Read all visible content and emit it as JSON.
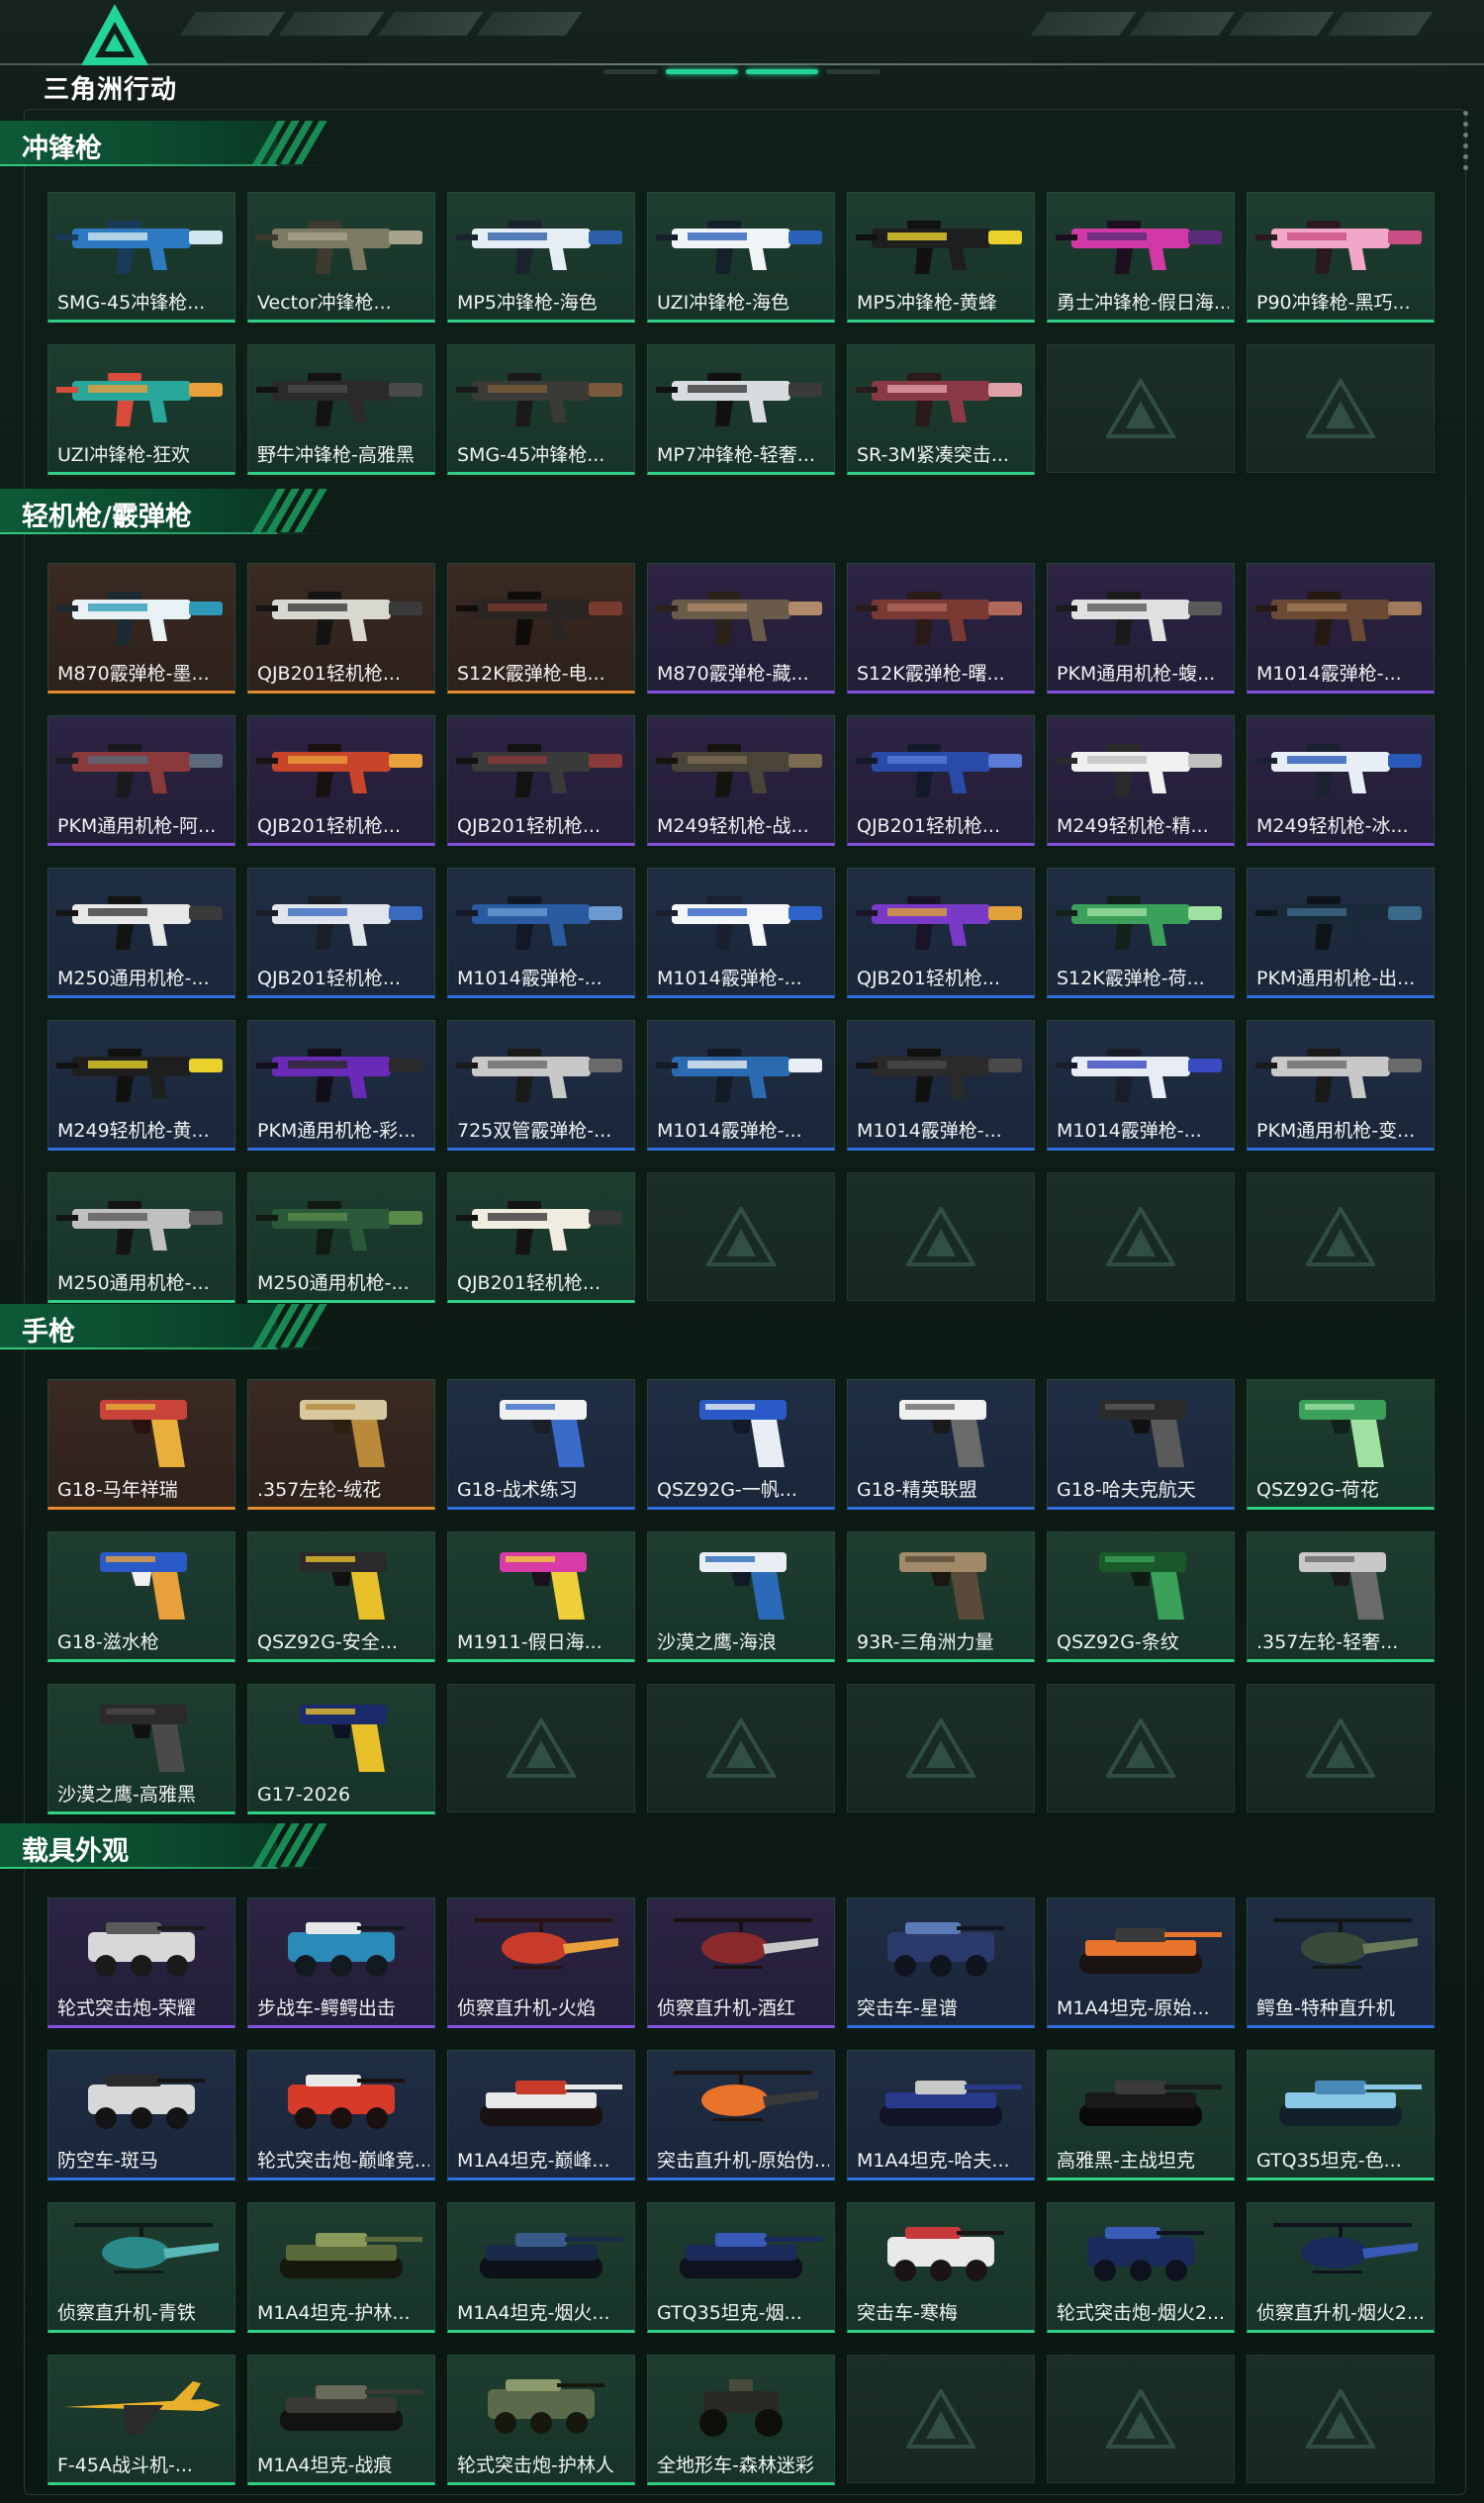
{
  "header": {
    "logo_text": "三角洲行动"
  },
  "sections": [
    {
      "title": "冲锋枪",
      "kind": "gun",
      "items": [
        {
          "label": "SMG-45冲锋枪...",
          "rarity": "green",
          "colors": [
            "#2e7ac2",
            "#d0e8f0",
            "#1a3a5a"
          ]
        },
        {
          "label": "Vector冲锋枪...",
          "rarity": "green",
          "colors": [
            "#7c7a63",
            "#a8a38c",
            "#3d3b30"
          ]
        },
        {
          "label": "MP5冲锋枪-海色",
          "rarity": "green",
          "colors": [
            "#e6eef5",
            "#2d5ea8",
            "#1b2230"
          ]
        },
        {
          "label": "UZI冲锋枪-海色",
          "rarity": "green",
          "colors": [
            "#f1f4f6",
            "#2b62b9",
            "#15202c"
          ]
        },
        {
          "label": "MP5冲锋枪-黄蜂",
          "rarity": "green",
          "colors": [
            "#1e1e1e",
            "#e8d22b",
            "#111111"
          ]
        },
        {
          "label": "勇士冲锋枪-假日海...",
          "rarity": "green",
          "colors": [
            "#d13aa6",
            "#5b2a7a",
            "#1a1020"
          ]
        },
        {
          "label": "P90冲锋枪-黑巧...",
          "rarity": "green",
          "colors": [
            "#f2a7c8",
            "#c94f86",
            "#2a1a20"
          ]
        },
        {
          "label": "UZI冲锋枪-狂欢",
          "rarity": "green",
          "colors": [
            "#29a79a",
            "#e8a03b",
            "#d84a3a"
          ]
        },
        {
          "label": "野牛冲锋枪-高雅黑",
          "rarity": "green",
          "colors": [
            "#2a2a2a",
            "#4a4a4a",
            "#121212"
          ]
        },
        {
          "label": "SMG-45冲锋枪...",
          "rarity": "green",
          "colors": [
            "#3a3a36",
            "#7a5a3a",
            "#1a1a1a"
          ]
        },
        {
          "label": "MP7冲锋枪-轻奢...",
          "rarity": "green",
          "colors": [
            "#d8dce0",
            "#3a3a3a",
            "#111111"
          ]
        },
        {
          "label": "SR-3M紧凑突击...",
          "rarity": "green",
          "colors": [
            "#8a3a44",
            "#e0a0a8",
            "#2a1a1c"
          ]
        },
        {
          "label": "",
          "rarity": "empty"
        },
        {
          "label": "",
          "rarity": "empty"
        }
      ]
    },
    {
      "title": "轻机枪/霰弹枪",
      "kind": "gun",
      "items": [
        {
          "label": "M870霰弹枪-墨...",
          "rarity": "orange",
          "colors": [
            "#e8f2f5",
            "#2f9ab8",
            "#1a2a30"
          ]
        },
        {
          "label": "QJB201轻机枪...",
          "rarity": "orange",
          "colors": [
            "#d8d8d0",
            "#3a3a3a",
            "#141414"
          ]
        },
        {
          "label": "S12K霰弹枪-电...",
          "rarity": "orange",
          "colors": [
            "#2a2422",
            "#7a3a30",
            "#100c0a"
          ]
        },
        {
          "label": "M870霰弹枪-藏...",
          "rarity": "purple",
          "colors": [
            "#6a5a4a",
            "#b08a6a",
            "#2a221a"
          ]
        },
        {
          "label": "S12K霰弹枪-曙...",
          "rarity": "purple",
          "colors": [
            "#7a3a34",
            "#b0685a",
            "#2a1a16"
          ]
        },
        {
          "label": "PKM通用机枪-蝮...",
          "rarity": "purple",
          "colors": [
            "#e0e0e0",
            "#5a5a5a",
            "#1a1a1a"
          ]
        },
        {
          "label": "M1014霰弹枪-...",
          "rarity": "purple",
          "colors": [
            "#6a4a34",
            "#a07a5a",
            "#241a12"
          ]
        },
        {
          "label": "PKM通用机枪-阿...",
          "rarity": "purple",
          "colors": [
            "#8a3a3a",
            "#5a6a7a",
            "#1a1a1e"
          ]
        },
        {
          "label": "QJB201轻机枪...",
          "rarity": "purple",
          "colors": [
            "#c8442a",
            "#e8a03a",
            "#1a1210"
          ]
        },
        {
          "label": "QJB201轻机枪...",
          "rarity": "purple",
          "colors": [
            "#3a3a3a",
            "#8a3a3a",
            "#121212"
          ]
        },
        {
          "label": "M249轻机枪-战...",
          "rarity": "purple",
          "colors": [
            "#4a4438",
            "#7a6a50",
            "#16140f"
          ]
        },
        {
          "label": "QJB201轻机枪...",
          "rarity": "purple",
          "colors": [
            "#2a4aa8",
            "#5a7ad8",
            "#121a2a"
          ]
        },
        {
          "label": "M249轻机枪-精...",
          "rarity": "purple",
          "colors": [
            "#f0f0f0",
            "#c0c0c0",
            "#2a2a2a"
          ]
        },
        {
          "label": "M249轻机枪-冰...",
          "rarity": "purple",
          "colors": [
            "#e8eef5",
            "#2a5ab8",
            "#1a2130"
          ]
        },
        {
          "label": "M250通用机枪-...",
          "rarity": "blue",
          "colors": [
            "#e8e8e8",
            "#3a3a3a",
            "#141414"
          ]
        },
        {
          "label": "QJB201轻机枪...",
          "rarity": "blue",
          "colors": [
            "#e0e6ec",
            "#3a6ac0",
            "#1a1e26"
          ]
        },
        {
          "label": "M1014霰弹枪-...",
          "rarity": "blue",
          "colors": [
            "#2a5aa0",
            "#6a9ad0",
            "#121826"
          ]
        },
        {
          "label": "M1014霰弹枪-...",
          "rarity": "blue",
          "colors": [
            "#f4f6f8",
            "#2f62c8",
            "#1a2030"
          ]
        },
        {
          "label": "QJB201轻机枪...",
          "rarity": "blue",
          "colors": [
            "#7a3ac8",
            "#e0a03a",
            "#1a1428"
          ]
        },
        {
          "label": "S12K霰弹枪-荷...",
          "rarity": "blue",
          "colors": [
            "#3aa05a",
            "#a0e0a0",
            "#12221a"
          ]
        },
        {
          "label": "PKM通用机枪-出...",
          "rarity": "blue",
          "colors": [
            "#1a2a3a",
            "#3a6a8a",
            "#0e141a"
          ]
        },
        {
          "label": "M249轻机枪-黄...",
          "rarity": "blue",
          "colors": [
            "#1e1e1e",
            "#e8d22b",
            "#111111"
          ]
        },
        {
          "label": "PKM通用机枪-彩...",
          "rarity": "blue",
          "colors": [
            "#6a2ab8",
            "#2a2a2a",
            "#120e1a"
          ]
        },
        {
          "label": "725双管霰弹枪-...",
          "rarity": "blue",
          "colors": [
            "#c8c8c8",
            "#6a6a6a",
            "#1a1a1a"
          ]
        },
        {
          "label": "M1014霰弹枪-...",
          "rarity": "blue",
          "colors": [
            "#2a6ab0",
            "#e8eef4",
            "#121a26"
          ]
        },
        {
          "label": "M1014霰弹枪-...",
          "rarity": "blue",
          "colors": [
            "#2a2a2a",
            "#4a4a4a",
            "#111111"
          ]
        },
        {
          "label": "M1014霰弹枪-...",
          "rarity": "blue",
          "colors": [
            "#e8ecf4",
            "#3a4ac0",
            "#1a1e2a"
          ]
        },
        {
          "label": "PKM通用机枪-变...",
          "rarity": "blue",
          "colors": [
            "#c8c8c8",
            "#6a6a6a",
            "#1a1a1a"
          ]
        },
        {
          "label": "M250通用机枪-...",
          "rarity": "green",
          "colors": [
            "#c0c0c0",
            "#5a5a5a",
            "#141414"
          ]
        },
        {
          "label": "M250通用机枪-...",
          "rarity": "green",
          "colors": [
            "#2a5a3a",
            "#5a8a4a",
            "#121a14"
          ]
        },
        {
          "label": "QJB201轻机枪...",
          "rarity": "green",
          "colors": [
            "#f0ece0",
            "#3a3a3a",
            "#141414"
          ]
        },
        {
          "label": "",
          "rarity": "empty"
        },
        {
          "label": "",
          "rarity": "empty"
        },
        {
          "label": "",
          "rarity": "empty"
        },
        {
          "label": "",
          "rarity": "empty"
        }
      ]
    },
    {
      "title": "手枪",
      "kind": "pistol",
      "items": [
        {
          "label": "G18-马年祥瑞",
          "rarity": "orange",
          "colors": [
            "#c8443a",
            "#e8b03a",
            "#2a1210"
          ]
        },
        {
          "label": ".357左轮-绒花",
          "rarity": "orange",
          "colors": [
            "#d8c8a0",
            "#b88a3a",
            "#2a2010"
          ]
        },
        {
          "label": "G18-战术练习",
          "rarity": "blue",
          "colors": [
            "#f0f0f0",
            "#3a6ac8",
            "#1a1e26"
          ]
        },
        {
          "label": "QSZ92G-一帆...",
          "rarity": "blue",
          "colors": [
            "#2a5ac8",
            "#e8eef4",
            "#121a2a"
          ]
        },
        {
          "label": "G18-精英联盟",
          "rarity": "blue",
          "colors": [
            "#f0f0f0",
            "#6a6a6a",
            "#1a1a1a"
          ]
        },
        {
          "label": "G18-哈夫克航天",
          "rarity": "blue",
          "colors": [
            "#2a2a2a",
            "#5a5a5a",
            "#111111"
          ]
        },
        {
          "label": "QSZ92G-荷花",
          "rarity": "green",
          "colors": [
            "#3aa05a",
            "#a0e0a0",
            "#12221a"
          ]
        },
        {
          "label": "G18-滋水枪",
          "rarity": "green",
          "colors": [
            "#2a5ac8",
            "#e8a03a",
            "#f0f0f0"
          ]
        },
        {
          "label": "QSZ92G-安全...",
          "rarity": "green",
          "colors": [
            "#2a2a2a",
            "#e8c02a",
            "#111111"
          ]
        },
        {
          "label": "M1911-假日海...",
          "rarity": "green",
          "colors": [
            "#d83aa6",
            "#f0d03a",
            "#1a1020"
          ]
        },
        {
          "label": "沙漠之鹰-海浪",
          "rarity": "green",
          "colors": [
            "#e8eef4",
            "#2a6ab8",
            "#121a26"
          ]
        },
        {
          "label": "93R-三角洲力量",
          "rarity": "green",
          "colors": [
            "#a08a6a",
            "#5a4a3a",
            "#1a1610"
          ]
        },
        {
          "label": "QSZ92G-条纹",
          "rarity": "green",
          "colors": [
            "#1a5a2a",
            "#3aa05a",
            "#0e1a12"
          ]
        },
        {
          "label": ".357左轮-轻奢...",
          "rarity": "green",
          "colors": [
            "#c8c8c8",
            "#6a6a6a",
            "#1a1a1a"
          ]
        },
        {
          "label": "沙漠之鹰-高雅黑",
          "rarity": "green",
          "colors": [
            "#2a2a2a",
            "#4a4a4a",
            "#111111"
          ]
        },
        {
          "label": "G17-2026",
          "rarity": "green",
          "colors": [
            "#1a2a6a",
            "#e8c02a",
            "#0e1226"
          ]
        },
        {
          "label": "",
          "rarity": "empty"
        },
        {
          "label": "",
          "rarity": "empty"
        },
        {
          "label": "",
          "rarity": "empty"
        },
        {
          "label": "",
          "rarity": "empty"
        },
        {
          "label": "",
          "rarity": "empty"
        }
      ]
    },
    {
      "title": "载具外观",
      "kind": "vehicle",
      "items": [
        {
          "label": "轮式突击炮-荣耀",
          "rarity": "purple",
          "colors": [
            "#d8d8d8",
            "#5a5a5a",
            "#1a1a1a"
          ],
          "vehicle": "wheeled"
        },
        {
          "label": "步战车-鳄鳄出击",
          "rarity": "purple",
          "colors": [
            "#2a8ab8",
            "#e8e8e8",
            "#121a20"
          ],
          "vehicle": "wheeled"
        },
        {
          "label": "侦察直升机-火焰",
          "rarity": "purple",
          "colors": [
            "#c83a2a",
            "#e8a03a",
            "#2a1210"
          ],
          "vehicle": "heli"
        },
        {
          "label": "侦察直升机-酒红",
          "rarity": "purple",
          "colors": [
            "#8a2a2a",
            "#c8c8c8",
            "#1a1010"
          ],
          "vehicle": "heli"
        },
        {
          "label": "突击车-星谱",
          "rarity": "blue",
          "colors": [
            "#2a3a6a",
            "#5a7ab8",
            "#10141e"
          ],
          "vehicle": "car"
        },
        {
          "label": "M1A4坦克-原始...",
          "rarity": "blue",
          "colors": [
            "#e8732a",
            "#3a3a3a",
            "#1a1410"
          ],
          "vehicle": "tank"
        },
        {
          "label": "鳄鱼-特种直升机",
          "rarity": "blue",
          "colors": [
            "#3a4a3a",
            "#6a7a5a",
            "#121612"
          ],
          "vehicle": "heli"
        },
        {
          "label": "防空车-斑马",
          "rarity": "blue",
          "colors": [
            "#d8d8d8",
            "#2a2a2a",
            "#141414"
          ],
          "vehicle": "wheeled"
        },
        {
          "label": "轮式突击炮-巅峰竞...",
          "rarity": "blue",
          "colors": [
            "#d83a2a",
            "#e8e8e8",
            "#1a1010"
          ],
          "vehicle": "car"
        },
        {
          "label": "M1A4坦克-巅峰...",
          "rarity": "blue",
          "colors": [
            "#e8e8e8",
            "#c83a2a",
            "#1a1212"
          ],
          "vehicle": "tank"
        },
        {
          "label": "突击直升机-原始伪...",
          "rarity": "blue",
          "colors": [
            "#e8732a",
            "#3a3a3a",
            "#1a1410"
          ],
          "vehicle": "heli"
        },
        {
          "label": "M1A4坦克-哈夫...",
          "rarity": "blue",
          "colors": [
            "#2a3a8a",
            "#c8c8c8",
            "#101426"
          ],
          "vehicle": "tank"
        },
        {
          "label": "高雅黑-主战坦克",
          "rarity": "green",
          "colors": [
            "#1a1a1a",
            "#3a3a3a",
            "#0a0a0a"
          ],
          "vehicle": "tank"
        },
        {
          "label": "GTQ35坦克-色...",
          "rarity": "green",
          "colors": [
            "#8ac8e8",
            "#4a8ab8",
            "#12202a"
          ],
          "vehicle": "tank"
        },
        {
          "label": "侦察直升机-青铁",
          "rarity": "green",
          "colors": [
            "#2a8a8a",
            "#5ab8b8",
            "#0e1a1a"
          ],
          "vehicle": "heli"
        },
        {
          "label": "M1A4坦克-护林...",
          "rarity": "green",
          "colors": [
            "#5a6a3a",
            "#8a9a5a",
            "#16180e"
          ],
          "vehicle": "tank"
        },
        {
          "label": "M1A4坦克-烟火...",
          "rarity": "green",
          "colors": [
            "#1a2a4a",
            "#3a5a8a",
            "#0e1218"
          ],
          "vehicle": "tank"
        },
        {
          "label": "GTQ35坦克-烟...",
          "rarity": "green",
          "colors": [
            "#1a2a5a",
            "#3a5ab8",
            "#0e121e"
          ],
          "vehicle": "tank"
        },
        {
          "label": "突击车-寒梅",
          "rarity": "green",
          "colors": [
            "#e8e8e8",
            "#c83a3a",
            "#1a1414"
          ],
          "vehicle": "car"
        },
        {
          "label": "轮式突击炮-烟火2...",
          "rarity": "green",
          "colors": [
            "#1a2a5a",
            "#3a5ab8",
            "#0e121e"
          ],
          "vehicle": "car"
        },
        {
          "label": "侦察直升机-烟火2...",
          "rarity": "green",
          "colors": [
            "#1a2a5a",
            "#3a5ab8",
            "#0e121e"
          ],
          "vehicle": "heli"
        },
        {
          "label": "F-45A战斗机-...",
          "rarity": "green",
          "colors": [
            "#e8b02a",
            "#2a2a2a",
            "#1a1610"
          ],
          "vehicle": "jet"
        },
        {
          "label": "M1A4坦克-战痕",
          "rarity": "green",
          "colors": [
            "#3a3a34",
            "#6a6a5a",
            "#121210"
          ],
          "vehicle": "tank"
        },
        {
          "label": "轮式突击炮-护林人",
          "rarity": "green",
          "colors": [
            "#5a6a4a",
            "#8a9a6a",
            "#16180e"
          ],
          "vehicle": "car"
        },
        {
          "label": "全地形车-森林迷彩",
          "rarity": "green",
          "colors": [
            "#2a2a24",
            "#4a4a3a",
            "#0e0e0a"
          ],
          "vehicle": "atv"
        },
        {
          "label": "",
          "rarity": "empty"
        },
        {
          "label": "",
          "rarity": "empty"
        },
        {
          "label": "",
          "rarity": "empty"
        }
      ]
    }
  ]
}
